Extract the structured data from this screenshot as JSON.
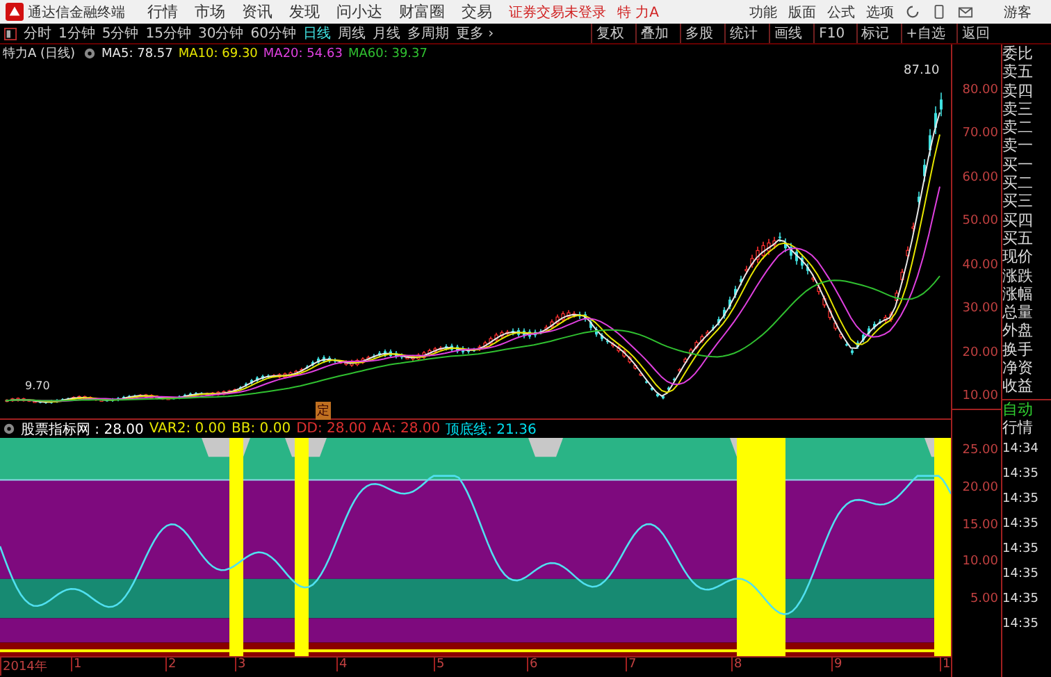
{
  "menubar": {
    "app_title": "通达信金融终端",
    "menus": [
      "行情",
      "市场",
      "资讯",
      "发现",
      "问小达",
      "财富圈",
      "交易"
    ],
    "login_status": "证券交易未登录",
    "stock_name": "特 力A",
    "right_menus": [
      "功能",
      "版面",
      "公式",
      "选项"
    ],
    "user": "游客"
  },
  "toolbar": {
    "periods": [
      {
        "label": "分时",
        "selected": false
      },
      {
        "label": "1分钟",
        "selected": false
      },
      {
        "label": "5分钟",
        "selected": false
      },
      {
        "label": "15分钟",
        "selected": false
      },
      {
        "label": "30分钟",
        "selected": false
      },
      {
        "label": "60分钟",
        "selected": false
      },
      {
        "label": "日线",
        "selected": true
      },
      {
        "label": "周线",
        "selected": false
      },
      {
        "label": "月线",
        "selected": false
      },
      {
        "label": "多周期",
        "selected": false
      },
      {
        "label": "更多 ›",
        "selected": false
      }
    ],
    "actions": [
      "复权",
      "叠加",
      "多股",
      "统计",
      "画线",
      "F10",
      "标记",
      "+自选",
      "返回"
    ]
  },
  "main_chart": {
    "title": "特力A (日线)",
    "indicators": [
      {
        "text": "MA5: 78.57",
        "color": "#e8e8e8"
      },
      {
        "text": "MA10: 69.30",
        "color": "#e6e600"
      },
      {
        "text": "MA20: 54.63",
        "color": "#e040e0"
      },
      {
        "text": "MA60: 39.37",
        "color": "#30c030"
      }
    ],
    "high_label": "87.10",
    "low_label": "9.70",
    "marker": "定",
    "price_ticks": [
      "80.00",
      "70.00",
      "60.00",
      "50.00",
      "40.00",
      "30.00",
      "20.00",
      "10.00"
    ]
  },
  "indicator_panel": {
    "values": [
      {
        "text": "股票指标网 : 28.00",
        "color": "#ffffff"
      },
      {
        "text": "VAR2: 0.00",
        "color": "#e6e600"
      },
      {
        "text": "BB: 0.00",
        "color": "#e6e600"
      },
      {
        "text": "DD: 28.00",
        "color": "#e03030"
      },
      {
        "text": "AA: 28.00",
        "color": "#e03030"
      },
      {
        "text": "顶底线: 21.36",
        "color": "#00e0f0"
      }
    ],
    "ticks": [
      "25.00",
      "20.00",
      "15.00",
      "10.00",
      "5.00"
    ]
  },
  "date_axis": [
    "2014年",
    "1",
    "2",
    "3",
    "4",
    "5",
    "6",
    "7",
    "8",
    "9",
    "1"
  ],
  "quote_panel": {
    "fields": [
      "委比",
      "卖五",
      "卖四",
      "卖三",
      "卖二",
      "卖一",
      "买一",
      "买二",
      "买三",
      "买四",
      "买五",
      "现价",
      "涨跌",
      "涨幅",
      "总量",
      "外盘",
      "换手",
      "净资",
      "收益"
    ],
    "mode": "自动",
    "section": "行情",
    "times": [
      "14:34",
      "14:35",
      "14:35",
      "14:35",
      "14:35",
      "14:35",
      "14:35",
      "14:35"
    ]
  }
}
